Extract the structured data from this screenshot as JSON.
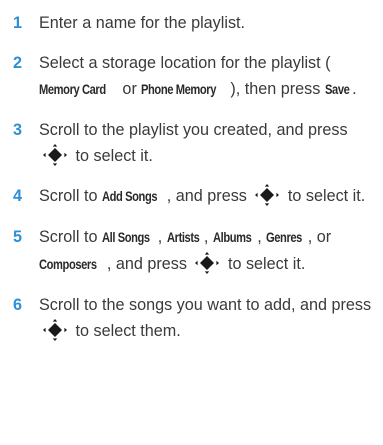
{
  "steps": [
    {
      "number": "1",
      "parts": [
        {
          "type": "text",
          "text": "Enter a name for the playlist."
        }
      ]
    },
    {
      "number": "2",
      "parts": [
        {
          "type": "text",
          "text": "Select a storage location for the playlist ("
        },
        {
          "type": "key",
          "text": "Memory Card"
        },
        {
          "type": "text",
          "text": " or "
        },
        {
          "type": "key",
          "text": "Phone Memory"
        },
        {
          "type": "text",
          "text": "), then press "
        },
        {
          "type": "key",
          "text": "Save"
        },
        {
          "type": "text",
          "text": "."
        }
      ]
    },
    {
      "number": "3",
      "parts": [
        {
          "type": "text",
          "text": "Scroll to the playlist you created, and press "
        },
        {
          "type": "icon",
          "icon": "nav-key-icon"
        },
        {
          "type": "text",
          "text": " to select it."
        }
      ]
    },
    {
      "number": "4",
      "parts": [
        {
          "type": "text",
          "text": "Scroll to "
        },
        {
          "type": "key",
          "text": "Add Songs"
        },
        {
          "type": "text",
          "text": ", and press "
        },
        {
          "type": "icon",
          "icon": "nav-key-icon"
        },
        {
          "type": "text",
          "text": " to select it."
        }
      ]
    },
    {
      "number": "5",
      "parts": [
        {
          "type": "text",
          "text": "Scroll to "
        },
        {
          "type": "key",
          "text": "All Songs"
        },
        {
          "type": "text",
          "text": ", "
        },
        {
          "type": "key",
          "text": "Artists"
        },
        {
          "type": "text",
          "text": ", "
        },
        {
          "type": "key",
          "text": "Albums"
        },
        {
          "type": "text",
          "text": ", "
        },
        {
          "type": "key",
          "text": "Genres"
        },
        {
          "type": "text",
          "text": ", or "
        },
        {
          "type": "key",
          "text": "Composers"
        },
        {
          "type": "text",
          "text": ", and press "
        },
        {
          "type": "icon",
          "icon": "nav-key-icon"
        },
        {
          "type": "text",
          "text": " to select it."
        }
      ]
    },
    {
      "number": "6",
      "parts": [
        {
          "type": "text",
          "text": "Scroll to the songs you want to add, and press "
        },
        {
          "type": "icon",
          "icon": "nav-key-icon"
        },
        {
          "type": "text",
          "text": " to select them."
        }
      ]
    }
  ],
  "colors": {
    "step_number": "#2e8fd6",
    "body_text": "#3a3a3a",
    "icon": "#1a1a1a"
  }
}
